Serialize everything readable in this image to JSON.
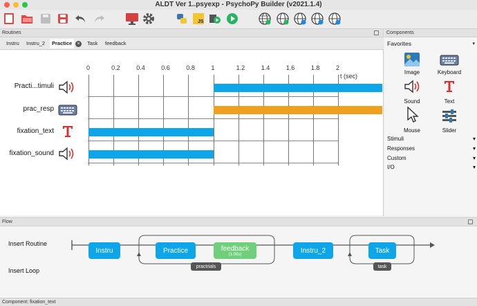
{
  "window": {
    "title": "ALDT Ver 1..psyexp - PsychoPy Builder (v2021.1.4)"
  },
  "toolbar": {
    "icons": [
      "new-file-icon",
      "open-folder-icon",
      "save-icon",
      "save-as-icon",
      "undo-icon",
      "redo-icon",
      "monitor-icon",
      "gear-icon",
      "python-icon",
      "js-icon",
      "compile-run-icon",
      "run-icon",
      "globe-icon",
      "globe-upload-icon",
      "globe-search-icon",
      "globe-info-icon",
      "globe-user-icon"
    ]
  },
  "routines": {
    "header": "Routines",
    "tabs": [
      "Instru",
      "Instru_2",
      "Practice",
      "Task",
      "feedback"
    ],
    "active_tab": "Practice",
    "time_unit": "t (sec)",
    "ticks": [
      "0",
      "0.2",
      "0.4",
      "0.6",
      "0.8",
      "1",
      "1.2",
      "1.4",
      "1.6",
      "1.8",
      "2"
    ],
    "components": [
      {
        "label": "Practi...timuli",
        "icon": "sound-icon"
      },
      {
        "label": "prac_resp",
        "icon": "keyboard-icon"
      },
      {
        "label": "fixation_text",
        "icon": "text-icon"
      },
      {
        "label": "fixation_sound",
        "icon": "sound-icon"
      }
    ]
  },
  "chart_data": {
    "type": "bar",
    "x_unit": "t (sec)",
    "xlim": [
      0,
      2
    ],
    "bars": [
      {
        "component": "Practi...timuli",
        "start": 1.0,
        "end": null,
        "color": "#0ea5e9"
      },
      {
        "component": "prac_resp",
        "start": 1.0,
        "end": null,
        "color": "#f0a020"
      },
      {
        "component": "fixation_text",
        "start": 0.0,
        "end": 1.0,
        "color": "#0ea5e9"
      },
      {
        "component": "fixation_sound",
        "start": 0.0,
        "end": 1.0,
        "color": "#0ea5e9"
      }
    ]
  },
  "components_panel": {
    "header": "Components",
    "favorites_label": "Favorites",
    "favorites": [
      {
        "label": "Image",
        "icon": "image-icon"
      },
      {
        "label": "Keyboard",
        "icon": "keyboard-icon"
      },
      {
        "label": "Sound",
        "icon": "sound-icon"
      },
      {
        "label": "Text",
        "icon": "text-icon"
      },
      {
        "label": "Mouse",
        "icon": "mouse-icon"
      },
      {
        "label": "Slider",
        "icon": "slider-icon"
      }
    ],
    "categories": [
      "Stimuli",
      "Responses",
      "Custom",
      "I/O"
    ]
  },
  "flow": {
    "header": "Flow",
    "insert_routine": "Insert Routine",
    "insert_loop": "Insert Loop",
    "routines": [
      {
        "label": "Instru",
        "sub": "",
        "color": "blue"
      },
      {
        "label": "Practice",
        "sub": "",
        "color": "blue"
      },
      {
        "label": "feedback",
        "sub": "(1.00s)",
        "color": "green"
      },
      {
        "label": "Instru_2",
        "sub": "",
        "color": "blue"
      },
      {
        "label": "Task",
        "sub": "",
        "color": "blue"
      }
    ],
    "loops": [
      "practrials",
      "task"
    ]
  },
  "status": {
    "text": "Component: fixation_text"
  }
}
